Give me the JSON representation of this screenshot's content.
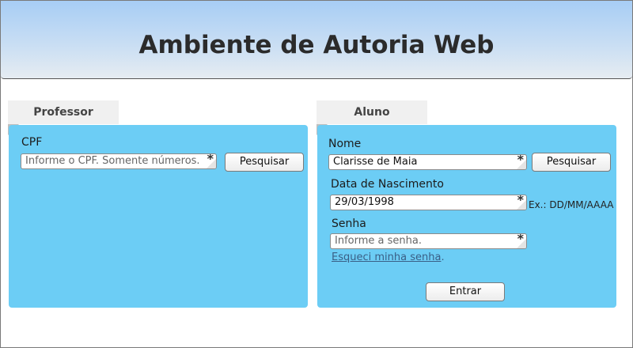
{
  "header": {
    "title": "Ambiente de Autoria Web"
  },
  "professor": {
    "tab_label": "Professor",
    "cpf_label": "CPF",
    "cpf_placeholder": "Informe o CPF. Somente números.",
    "required_mark": "*",
    "search_button": "Pesquisar"
  },
  "aluno": {
    "tab_label": "Aluno",
    "nome_label": "Nome",
    "nome_value": "Clarisse de Maia",
    "search_button": "Pesquisar",
    "nascimento_label": "Data de Nascimento",
    "nascimento_value": "29/03/1998",
    "nascimento_hint": "Ex.: DD/MM/AAAA",
    "senha_label": "Senha",
    "senha_placeholder": "Informe a senha.",
    "forgot_link": "Esqueci minha senha",
    "forgot_suffix": ".",
    "required_mark": "*",
    "enter_button": "Entrar"
  }
}
